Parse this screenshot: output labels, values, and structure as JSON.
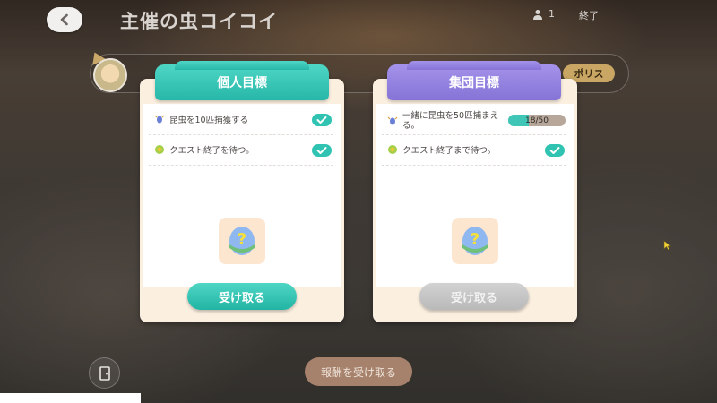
{
  "header": {
    "title": "主催の虫コイコイ",
    "player_count": "1",
    "end_label": "終了"
  },
  "profile": {
    "badge_label": "ポリス"
  },
  "personal": {
    "tab_label": "個人目標",
    "objectives": [
      {
        "text": "昆虫を10匹捕獲する",
        "icon": "bug-icon",
        "completed": true
      },
      {
        "text": "クエスト終了を待つ。",
        "icon": "flower-icon",
        "completed": true
      }
    ],
    "reward_icon": "mystery-egg-icon",
    "claim_label": "受け取る",
    "claim_enabled": true
  },
  "group": {
    "tab_label": "集団目標",
    "objectives": [
      {
        "text": "一緒に昆虫を50匹捕まえる。",
        "icon": "bug-icon",
        "progress_text": "18/50",
        "progress": 0.36
      },
      {
        "text": "クエスト終了まで待つ。",
        "icon": "flower-icon",
        "completed": true
      }
    ],
    "reward_icon": "mystery-egg-icon",
    "claim_label": "受け取る",
    "claim_enabled": false
  },
  "footer": {
    "claim_rewards_label": "報酬を受け取る"
  },
  "colors": {
    "teal": "#30c3b2",
    "purple": "#8f7fe0",
    "cream": "#fbefe0",
    "disabled": "#c6c6c6"
  }
}
